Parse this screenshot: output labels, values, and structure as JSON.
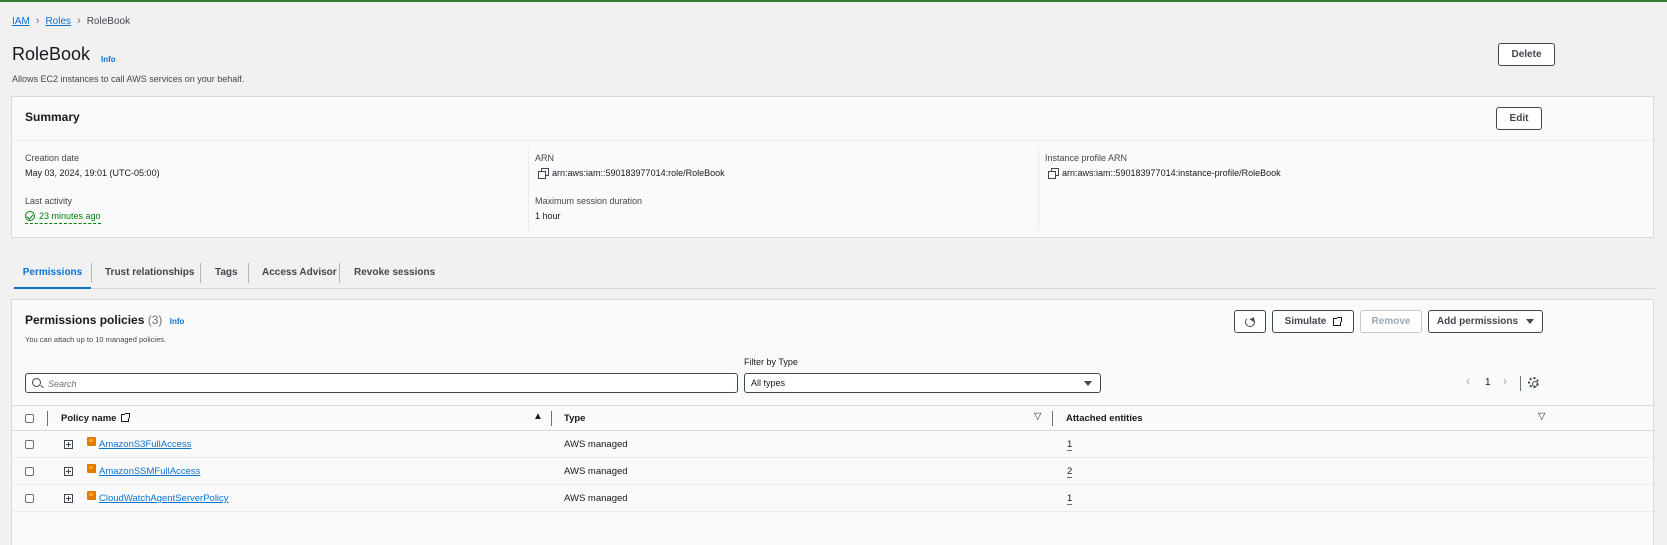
{
  "breadcrumb": {
    "items": [
      "IAM",
      "Roles"
    ],
    "current": "RoleBook"
  },
  "header": {
    "title": "RoleBook",
    "info": "Info",
    "description": "Allows EC2 instances to call AWS services on your behalf.",
    "delete_label": "Delete"
  },
  "summary": {
    "title": "Summary",
    "edit_label": "Edit",
    "creation_date_label": "Creation date",
    "creation_date": "May 03, 2024, 19:01 (UTC-05:00)",
    "last_activity_label": "Last activity",
    "last_activity": "23 minutes ago",
    "arn_label": "ARN",
    "arn": "arn:aws:iam::590183977014:role/RoleBook",
    "max_session_label": "Maximum session duration",
    "max_session": "1 hour",
    "instance_profile_label": "Instance profile ARN",
    "instance_profile": "arn:aws:iam::590183977014:instance-profile/RoleBook"
  },
  "tabs": [
    "Permissions",
    "Trust relationships",
    "Tags",
    "Access Advisor",
    "Revoke sessions"
  ],
  "permissions": {
    "title": "Permissions policies",
    "count": "(3)",
    "info": "Info",
    "description": "You can attach up to 10 managed policies.",
    "simulate_label": "Simulate",
    "remove_label": "Remove",
    "add_label": "Add permissions",
    "filter_label": "Filter by Type",
    "search_placeholder": "Search",
    "filter_value": "All types",
    "page": "1",
    "columns": [
      "Policy name",
      "Type",
      "Attached entities"
    ],
    "rows": [
      {
        "name": "AmazonS3FullAccess",
        "type": "AWS managed",
        "entities": "1"
      },
      {
        "name": "AmazonSSMFullAccess",
        "type": "AWS managed",
        "entities": "2"
      },
      {
        "name": "CloudWatchAgentServerPolicy",
        "type": "AWS managed",
        "entities": "1"
      }
    ]
  },
  "colors": {
    "accent": "#0972d3",
    "success": "#037f0c",
    "top_bar": "#2e7d32"
  }
}
